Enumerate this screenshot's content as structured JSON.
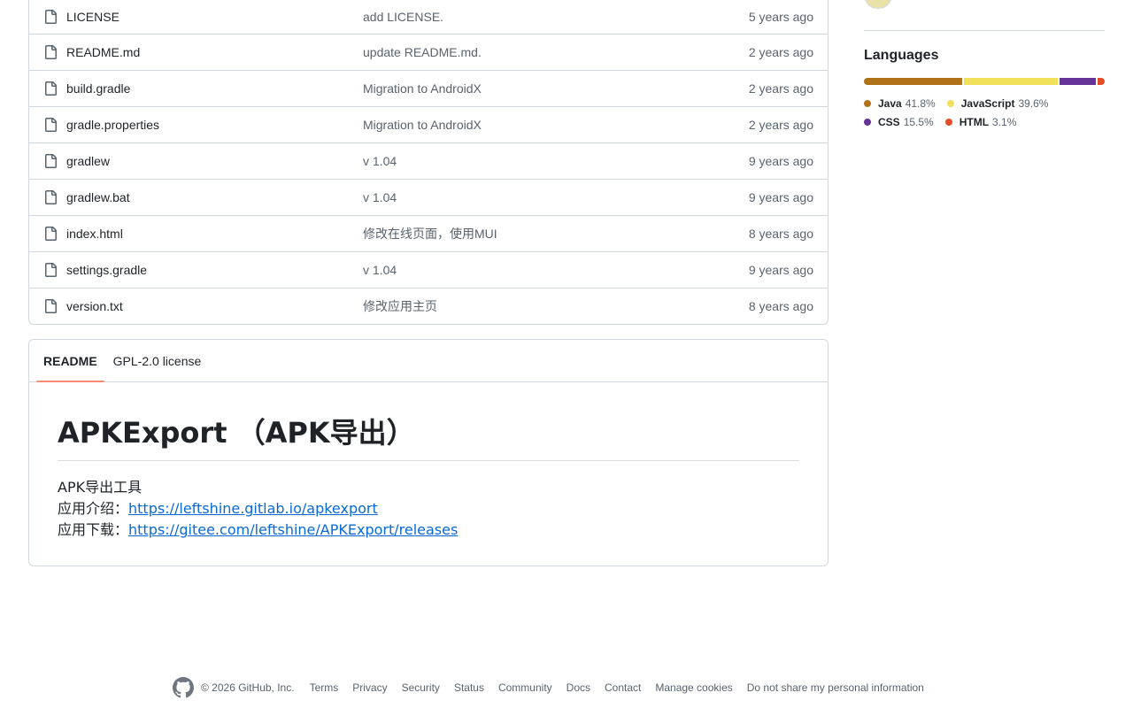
{
  "files": [
    {
      "name": "LICENSE",
      "message": "add LICENSE.",
      "date": "5 years ago"
    },
    {
      "name": "README.md",
      "message": "update README.md.",
      "date": "2 years ago"
    },
    {
      "name": "build.gradle",
      "message": "Migration to AndroidX",
      "date": "2 years ago"
    },
    {
      "name": "gradle.properties",
      "message": "Migration to AndroidX",
      "date": "2 years ago"
    },
    {
      "name": "gradlew",
      "message": "v 1.04",
      "date": "9 years ago"
    },
    {
      "name": "gradlew.bat",
      "message": "v 1.04",
      "date": "9 years ago"
    },
    {
      "name": "index.html",
      "message": "修改在线页面，使用MUI",
      "date": "8 years ago"
    },
    {
      "name": "settings.gradle",
      "message": "v 1.04",
      "date": "9 years ago"
    },
    {
      "name": "version.txt",
      "message": "修改应用主页",
      "date": "8 years ago"
    }
  ],
  "readme": {
    "tabs": [
      "README",
      "GPL-2.0 license"
    ],
    "title": "APKExport （APK导出）",
    "line1": "APK导出工具",
    "line2_label": "应用介绍：",
    "line2_link": "https://leftshine.gitlab.io/apkexport",
    "line3_label": "应用下载：",
    "line3_link": "https://gitee.com/leftshine/APKExport/releases"
  },
  "languages": {
    "heading": "Languages",
    "items": [
      {
        "name": "Java",
        "percent": "41.8%",
        "value": 41.8,
        "color": "#b07219"
      },
      {
        "name": "JavaScript",
        "percent": "39.6%",
        "value": 39.6,
        "color": "#f1e05a"
      },
      {
        "name": "CSS",
        "percent": "15.5%",
        "value": 15.5,
        "color": "#663399"
      },
      {
        "name": "HTML",
        "percent": "3.1%",
        "value": 3.1,
        "color": "#e34c26"
      }
    ]
  },
  "footer": {
    "copyright": "© 2026 GitHub, Inc.",
    "links": [
      "Terms",
      "Privacy",
      "Security",
      "Status",
      "Community",
      "Docs",
      "Contact",
      "Manage cookies",
      "Do not share my personal information"
    ]
  }
}
